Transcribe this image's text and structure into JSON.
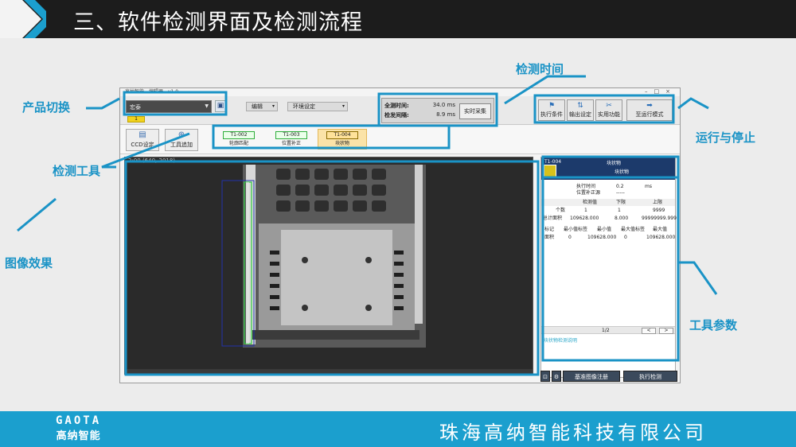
{
  "slide": {
    "title": "三、软件检测界面及检测流程",
    "brand_logo": "GAOTA",
    "brand_name": "高纳智能",
    "company": "珠海高纳智能科技有限公司",
    "accent_color": "#1b9fce"
  },
  "callouts": {
    "product_switch": "产品切换",
    "detection_time": "检测时间",
    "run_stop": "运行与停止",
    "detection_tool": "检测工具",
    "image_effect": "图像效果",
    "tool_params": "工具参数"
  },
  "app": {
    "window_title": "高纳智能 - 编辑器 - v1.0",
    "product_select": "宏泰",
    "product_tag": "1",
    "menu_edit": "编辑",
    "menu_env": "环境设定",
    "total_time_label": "全测时间:",
    "total_time_value": "34.0 ms",
    "trigger_interval_label": "检发间隔:",
    "trigger_interval_value": "8.9 ms",
    "realtime_button": "实时采集",
    "run_buttons": [
      "执行条件",
      "输出设定",
      "实用功能",
      "至运行模式"
    ],
    "tool_buttons": [
      "CCD设定",
      "工具追加"
    ],
    "tools": [
      {
        "id": "T1-002",
        "label": "轮廓匹配"
      },
      {
        "id": "T1-003",
        "label": "位置补正"
      },
      {
        "id": "T1-004",
        "label": "块状物"
      }
    ],
    "image_info": "2:00    (640, 2018)",
    "params": {
      "header_id": "T1-004",
      "header_title": "块状物",
      "header_sub": "块状物",
      "exec_time_label": "执行时间",
      "exec_time_value": "0.2",
      "exec_time_unit": "ms",
      "pos_correct_label": "位置补正源",
      "pos_correct_value": "-----",
      "col_headers": [
        "检测值",
        "下限",
        "上限"
      ],
      "rows": [
        {
          "name": "个数",
          "value": "1",
          "low": "1",
          "high": "9999"
        },
        {
          "name": "总计面积",
          "value": "109628.000",
          "low": "8.000",
          "high": "99999999.999"
        }
      ],
      "detail_headers": [
        "标记",
        "最小值标签",
        "最小值",
        "最大值标签",
        "最大值"
      ],
      "detail_row": [
        "面积",
        "0",
        "109628.000",
        "0",
        "109628.000"
      ],
      "page": "1/2",
      "prev": "<",
      "next": ">",
      "foot_text": "块状物检测说明"
    },
    "bottom_buttons": [
      "基准图像注册",
      "执行检测"
    ]
  }
}
